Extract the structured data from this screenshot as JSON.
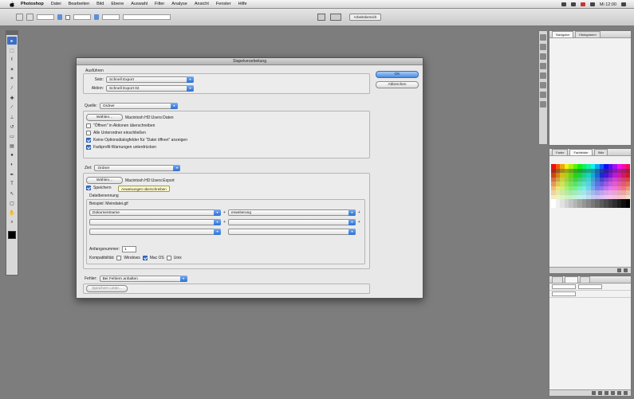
{
  "menubar": {
    "app": "Photoshop",
    "items": [
      "Datei",
      "Bearbeiten",
      "Bild",
      "Ebene",
      "Auswahl",
      "Filter",
      "Analyse",
      "Ansicht",
      "Fenster",
      "Hilfe"
    ],
    "clock": "Mi 12:00"
  },
  "options_bar": {
    "workspace": "Arbeitsbereich"
  },
  "dialog": {
    "title": "Stapelverarbeitung",
    "ok_label": "OK",
    "cancel_label": "Abbrechen",
    "play": {
      "title": "Ausführen",
      "set_label": "Satz:",
      "set_value": "Schnell Export",
      "action_label": "Aktion:",
      "action_value": "Schnell Export 02"
    },
    "source": {
      "label": "Quelle:",
      "value": "Ordner",
      "choose_label": "Wählen...",
      "path_note": "Macintosh HD:Users:Daten",
      "options": [
        {
          "label": "\"Öffnen\" in Aktionen überschreiben",
          "checked": false
        },
        {
          "label": "Alle Unterordner einschließen",
          "checked": false
        },
        {
          "label": "Keine Optionsdialogfelder für \"Datei öffnen\" anzeigen",
          "checked": true
        },
        {
          "label": "Farbprofil-Warnungen unterdrücken",
          "checked": true
        }
      ]
    },
    "destination": {
      "label": "Ziel:",
      "value": "Ordner",
      "choose_label": "Wählen...",
      "path_note": "Macintosh HD:Users:Export",
      "override_label": "Speichern",
      "override_checked": true,
      "tooltip": "Anweisungen überschreiben",
      "naming_title": "Dateibenennung",
      "example": "Beispiel: Meindatei.gif",
      "name_rows": [
        {
          "left": "Dokumentname",
          "right": "erweiterung",
          "plus": "+"
        },
        {
          "left": "",
          "right": "",
          "plus": "+"
        },
        {
          "left": "",
          "right": "",
          "plus": ""
        }
      ],
      "start_number_label": "Anfangsnummer:",
      "start_number_value": "1",
      "compat_label": "Kompatibilität:",
      "compat_options": [
        {
          "label": "Windows",
          "on": false
        },
        {
          "label": "Mac OS",
          "on": true
        },
        {
          "label": "Unix",
          "on": false
        }
      ]
    },
    "errors": {
      "label": "Fehler:",
      "value": "Bei Fehlern anhalten",
      "save_label": "Speichern unter..."
    }
  },
  "panels": {
    "top_tabs": [
      "Navigator",
      "Histogramm"
    ],
    "swatch_tabs": [
      "Farbe",
      "Farbfelder",
      "Stile"
    ]
  },
  "colors": {
    "desktop": "#7d7d7d",
    "accent": "#3b74d2",
    "dialog_bg": "#e8e8e8"
  }
}
